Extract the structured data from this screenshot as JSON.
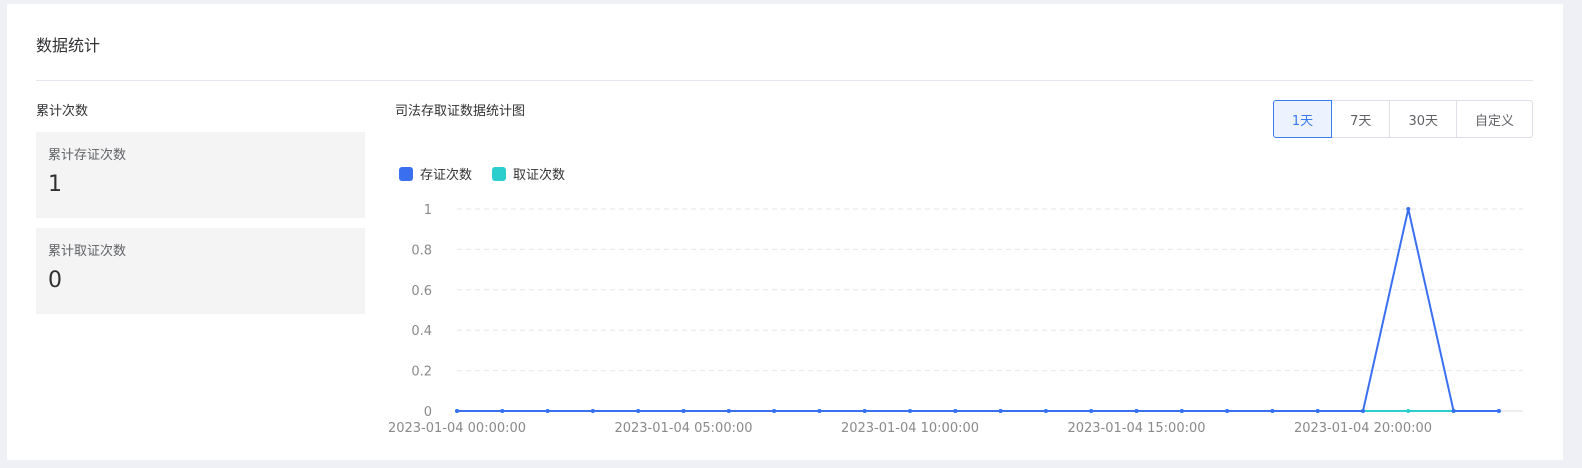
{
  "panel": {
    "title": "数据统计"
  },
  "cumulative": {
    "section_label": "累计次数",
    "cards": [
      {
        "label": "累计存证次数",
        "value": "1"
      },
      {
        "label": "累计取证次数",
        "value": "0"
      }
    ]
  },
  "chart_panel": {
    "title": "司法存取证数据统计图",
    "ranges": [
      {
        "label": "1天",
        "active": true
      },
      {
        "label": "7天",
        "active": false
      },
      {
        "label": "30天",
        "active": false
      },
      {
        "label": "自定义",
        "active": false
      }
    ]
  },
  "colors": {
    "series_store": "#3a70f0",
    "series_retrieve": "#2ccdcd",
    "accent": "#3a7bf0"
  },
  "chart_data": {
    "type": "line",
    "x": [
      "2023-01-04 00:00:00",
      "2023-01-04 01:00:00",
      "2023-01-04 02:00:00",
      "2023-01-04 03:00:00",
      "2023-01-04 04:00:00",
      "2023-01-04 05:00:00",
      "2023-01-04 06:00:00",
      "2023-01-04 07:00:00",
      "2023-01-04 08:00:00",
      "2023-01-04 09:00:00",
      "2023-01-04 10:00:00",
      "2023-01-04 11:00:00",
      "2023-01-04 12:00:00",
      "2023-01-04 13:00:00",
      "2023-01-04 14:00:00",
      "2023-01-04 15:00:00",
      "2023-01-04 16:00:00",
      "2023-01-04 17:00:00",
      "2023-01-04 18:00:00",
      "2023-01-04 19:00:00",
      "2023-01-04 20:00:00",
      "2023-01-04 21:00:00",
      "2023-01-04 22:00:00",
      "2023-01-04 23:00:00"
    ],
    "x_tick_labels": [
      "2023-01-04 00:00:00",
      "2023-01-04 05:00:00",
      "2023-01-04 10:00:00",
      "2023-01-04 15:00:00",
      "2023-01-04 20:00:00"
    ],
    "y_tick_labels": [
      "0",
      "0.2",
      "0.4",
      "0.6",
      "0.8",
      "1"
    ],
    "ylim": [
      0,
      1
    ],
    "grid": true,
    "legend_placement": "top-left",
    "series": [
      {
        "name": "存证次数",
        "values": [
          0,
          0,
          0,
          0,
          0,
          0,
          0,
          0,
          0,
          0,
          0,
          0,
          0,
          0,
          0,
          0,
          0,
          0,
          0,
          0,
          0,
          1,
          0,
          0
        ]
      },
      {
        "name": "取证次数",
        "values": [
          0,
          0,
          0,
          0,
          0,
          0,
          0,
          0,
          0,
          0,
          0,
          0,
          0,
          0,
          0,
          0,
          0,
          0,
          0,
          0,
          0,
          0,
          0,
          0
        ]
      }
    ]
  }
}
